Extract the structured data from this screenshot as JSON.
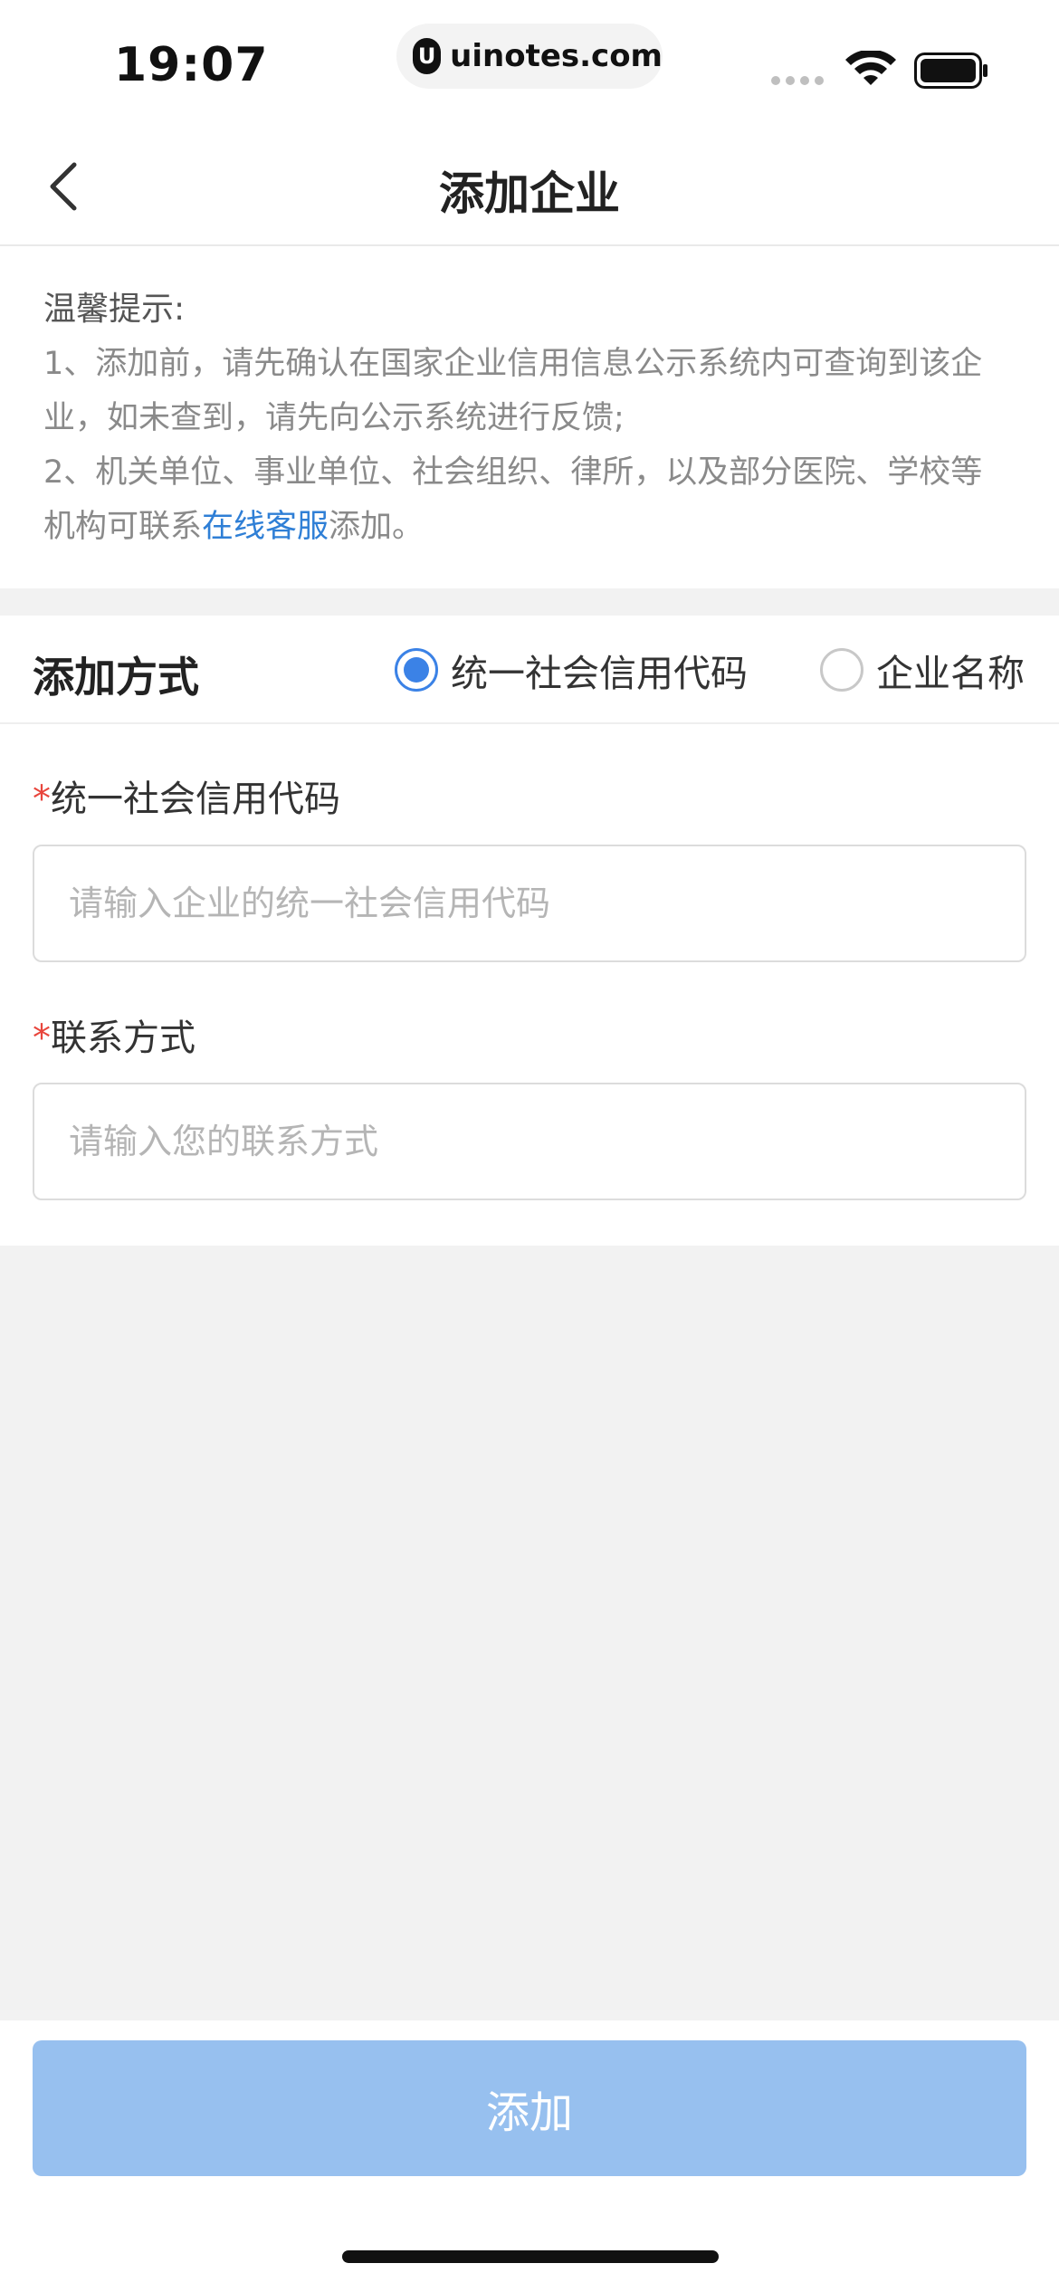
{
  "status_bar": {
    "time": "19:07",
    "url": "uinotes.com"
  },
  "nav": {
    "title": "添加企业"
  },
  "tips": {
    "title": "温馨提示:",
    "line1": "1、添加前，请先确认在国家企业信用信息公示系统内可查询到该企",
    "line2": "业，如未查到，请先向公示系统进行反馈;",
    "line3": "2、机关单位、事业单位、社会组织、律所，以及部分医院、学校等",
    "line4_prefix": "机构可联系",
    "line4_link": "在线客服",
    "line4_suffix": "添加。"
  },
  "method": {
    "label": "添加方式",
    "options": [
      {
        "label": "统一社会信用代码",
        "checked": true
      },
      {
        "label": "企业名称",
        "checked": false
      }
    ]
  },
  "form": {
    "credit_code": {
      "required_mark": "*",
      "label": "统一社会信用代码",
      "value": "",
      "placeholder": "请输入企业的统一社会信用代码"
    },
    "contact": {
      "required_mark": "*",
      "label": "联系方式",
      "value": "",
      "placeholder": "请输入您的联系方式"
    }
  },
  "submit": {
    "label": "添加"
  },
  "colors": {
    "accent": "#3b82e6",
    "link": "#2f7fd6",
    "button_disabled": "#97c0ef",
    "required": "#e8453c"
  }
}
